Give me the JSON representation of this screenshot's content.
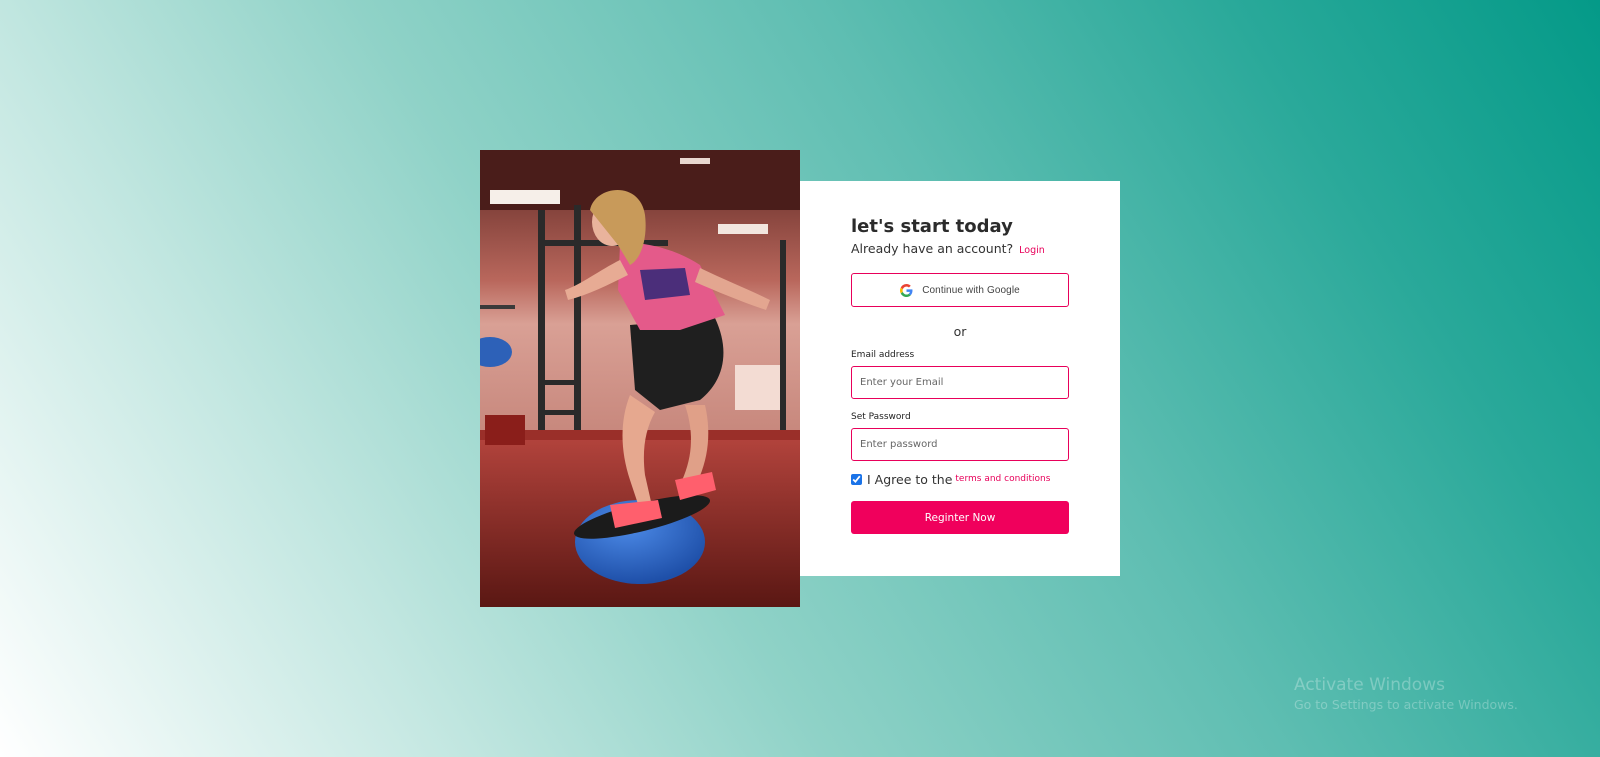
{
  "colors": {
    "accent": "#e8005a",
    "button": "#f0005c",
    "card": "#ffffff",
    "background_start": "#ffffff",
    "background_end": "#049a88"
  },
  "hero": {
    "icon": "fitness-photo"
  },
  "form": {
    "title": "let's start today",
    "subtitle": "Already have an account?",
    "login_link": "Login",
    "google_button_label": "Continue with Google",
    "google_icon": "google-g-icon",
    "divider_text": "or",
    "email": {
      "label": "Email address",
      "placeholder": "Enter your Email",
      "value": ""
    },
    "password": {
      "label": "Set Password",
      "placeholder": "Enter password",
      "value": ""
    },
    "agree": {
      "checked": true,
      "text": "I Agree to the",
      "link": "terms and conditions"
    },
    "submit_label": "Reginter Now"
  },
  "watermark": {
    "line1": "Activate Windows",
    "line2": "Go to Settings to activate Windows."
  }
}
